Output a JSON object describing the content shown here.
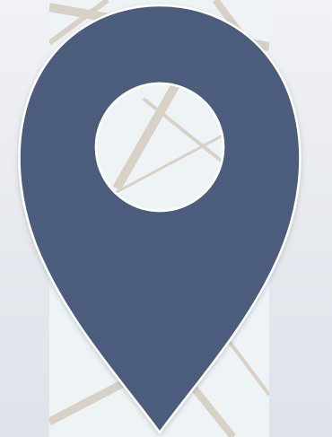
{
  "scene": {
    "icon": "location-pin-icon",
    "colors": {
      "background": "#e4e7ed",
      "map_panel": "#eef4f6",
      "map_roads": "#d8d1c6",
      "pin": "#4b5b7b",
      "pin_outline": "#ffffff",
      "pin_hole": "#eef4f6"
    }
  }
}
